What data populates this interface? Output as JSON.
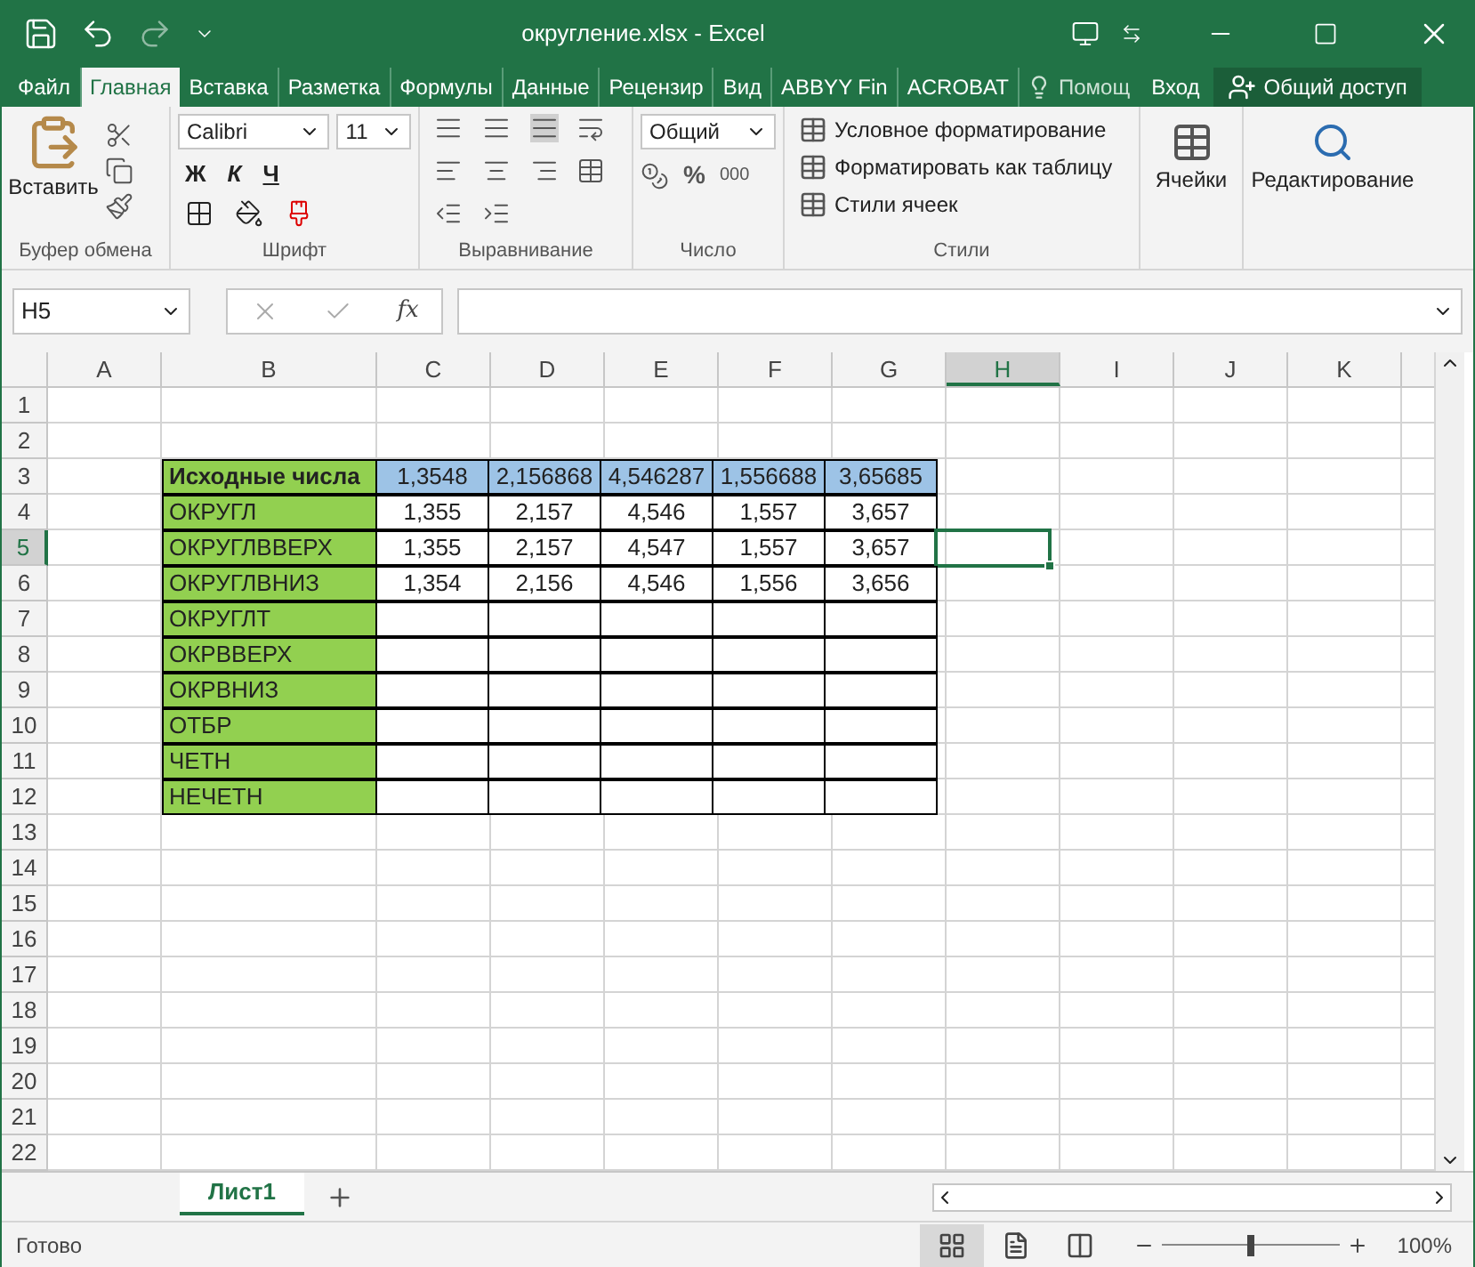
{
  "window": {
    "title": "округление.xlsx - Excel"
  },
  "ribbon_tabs": [
    {
      "label": "Файл",
      "selected": false
    },
    {
      "label": "Главная",
      "selected": true
    },
    {
      "label": "Вставка",
      "selected": false
    },
    {
      "label": "Разметка",
      "selected": false
    },
    {
      "label": "Формулы",
      "selected": false
    },
    {
      "label": "Данные",
      "selected": false
    },
    {
      "label": "Рецензир",
      "selected": false
    },
    {
      "label": "Вид",
      "selected": false
    },
    {
      "label": "ABBYY Fin",
      "selected": false
    },
    {
      "label": "ACROBAT",
      "selected": false
    }
  ],
  "tell_me": "Помощ",
  "sign_in": "Вход",
  "share": "Общий доступ",
  "ribbon": {
    "paste": "Вставить",
    "font": "Calibri",
    "size": "11",
    "bold": "Ж",
    "italic": "К",
    "underline": "Ч",
    "number_format": "Общий",
    "percent": "%",
    "thousands": "000",
    "styles": [
      "Условное форматирование",
      "Форматировать как таблицу",
      "Стили ячеек"
    ],
    "cells": "Ячейки",
    "editing": "Редактирование",
    "groups": [
      "Буфер обмена",
      "Шрифт",
      "Выравнивание",
      "Число",
      "Стили"
    ]
  },
  "formula_bar": {
    "name_box": "H5",
    "fx": "fx"
  },
  "columns": [
    {
      "label": "A",
      "selected": false
    },
    {
      "label": "B",
      "selected": false
    },
    {
      "label": "C",
      "selected": false
    },
    {
      "label": "D",
      "selected": false
    },
    {
      "label": "E",
      "selected": false
    },
    {
      "label": "F",
      "selected": false
    },
    {
      "label": "G",
      "selected": false
    },
    {
      "label": "H",
      "selected": true
    },
    {
      "label": "I",
      "selected": false
    },
    {
      "label": "J",
      "selected": false
    },
    {
      "label": "K",
      "selected": false
    }
  ],
  "rows": [
    {
      "number": "1",
      "selected": false,
      "kind": "plain"
    },
    {
      "number": "2",
      "selected": false,
      "kind": "plain"
    },
    {
      "number": "3",
      "selected": false,
      "kind": "header",
      "label": "Исходные числа",
      "values": [
        "1,3548",
        "2,156868",
        "4,546287",
        "1,556688",
        "3,65685"
      ]
    },
    {
      "number": "4",
      "selected": false,
      "kind": "data",
      "label": "ОКРУГЛ",
      "values": [
        "1,355",
        "2,157",
        "4,546",
        "1,557",
        "3,657"
      ]
    },
    {
      "number": "5",
      "selected": true,
      "kind": "data",
      "label": "ОКРУГЛВВЕРХ",
      "values": [
        "1,355",
        "2,157",
        "4,547",
        "1,557",
        "3,657"
      ]
    },
    {
      "number": "6",
      "selected": false,
      "kind": "data",
      "label": "ОКРУГЛВНИЗ",
      "values": [
        "1,354",
        "2,156",
        "4,546",
        "1,556",
        "3,656"
      ]
    },
    {
      "number": "7",
      "selected": false,
      "kind": "data",
      "label": "ОКРУГЛТ"
    },
    {
      "number": "8",
      "selected": false,
      "kind": "data",
      "label": "ОКРВВЕРХ"
    },
    {
      "number": "9",
      "selected": false,
      "kind": "data",
      "label": "ОКРВНИЗ"
    },
    {
      "number": "10",
      "selected": false,
      "kind": "data",
      "label": "ОТБР"
    },
    {
      "number": "11",
      "selected": false,
      "kind": "data",
      "label": "ЧЕТН"
    },
    {
      "number": "12",
      "selected": false,
      "kind": "data",
      "label": "НЕЧЕТН"
    },
    {
      "number": "13",
      "selected": false,
      "kind": "plain"
    },
    {
      "number": "14",
      "selected": false,
      "kind": "plain"
    },
    {
      "number": "15",
      "selected": false,
      "kind": "plain"
    },
    {
      "number": "16",
      "selected": false,
      "kind": "plain"
    },
    {
      "number": "17",
      "selected": false,
      "kind": "plain"
    },
    {
      "number": "18",
      "selected": false,
      "kind": "plain"
    },
    {
      "number": "19",
      "selected": false,
      "kind": "plain"
    },
    {
      "number": "20",
      "selected": false,
      "kind": "plain"
    },
    {
      "number": "21",
      "selected": false,
      "kind": "plain"
    },
    {
      "number": "22",
      "selected": false,
      "kind": "plain"
    }
  ],
  "sheet_tabs": [
    {
      "label": "Лист1",
      "selected": true
    }
  ],
  "status_bar": {
    "text": "Готово",
    "view": [
      {
        "kind": "normal",
        "selected": true
      },
      {
        "kind": "layout",
        "selected": false
      },
      {
        "kind": "pagebreak",
        "selected": false
      }
    ],
    "zoom": {
      "level": 0.5
    },
    "zoom_text": "100%"
  }
}
